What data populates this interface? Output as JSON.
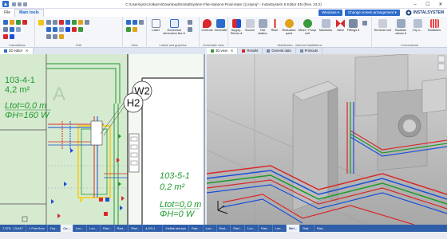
{
  "window": {
    "title": "C:\\Users\\pszczolkarm\\Downloads\\InstalSystem-Flat-stations-Final-state (1).isproj* - InstalSystem 5 Editor EN (Rev. 23.2)",
    "minimize": "–",
    "maximize": "☐",
    "close": "✕"
  },
  "tabs": {
    "file": "File",
    "main_tools": "Main tools"
  },
  "ribbon_right": {
    "windows": "Windows ▾",
    "arrangement": "Change screen arrangement ▾",
    "brand": "INSTALSYSTEM"
  },
  "groups": {
    "calculations": "Calculations",
    "edit": "Edit",
    "view": "View",
    "labels": "Labels and graphics",
    "schematic": "Schematic view",
    "distribution": "Distribution - internal installations",
    "conventional": "Conventional"
  },
  "buttons": {
    "label": "Label",
    "horizontal_dim": "Horizontal dimension line ▾",
    "controls": "Controls",
    "generate": "Generate",
    "supply_return": "Supply-Return ▾",
    "source": "Source",
    "flat_station": "Flat station",
    "riser": "Riser",
    "reduction_point": "Reduction point",
    "mixer_pump": "Mixer / Pump unit",
    "manifolds": "Manifolds",
    "valve": "Valve",
    "fittings": "Fittings ▾",
    "terminal_unit": "Terminal unit",
    "radiator_valves": "Radiator valves ▾",
    "dry_sections": "Dry s...",
    "radiators": "Radiators"
  },
  "doc_tabs": {
    "editor_2d": "2D editor",
    "view_3d": "3D view",
    "results": "Results",
    "general_data": "General data",
    "printouts": "Printouts"
  },
  "drawing": {
    "room_left_number": "103-4-1",
    "room_left_area": "4,2 m²",
    "room_left_length": "Ltot=0,0 m",
    "room_left_power": "ΦH=160 W",
    "room_a_letter": "A",
    "room_mid_number": "103-5-1",
    "room_mid_area": "0,2 m²",
    "room_mid_length": "Ltot=0,0 m",
    "room_mid_power": "ΦH=0 W",
    "bubble_w2": "W2",
    "bubble_h2": "H2"
  },
  "status": {
    "coords": "7,375; -13,647",
    "tabs_left": [
      "1 First floor",
      "Dry...",
      "Co...",
      "Loo...",
      "Loo...",
      "Rad...",
      "Rad...",
      "Rad...",
      "4,2/0,1"
    ],
    "tabs_right": [
      "Visible storeys",
      "Rad...",
      "Loo...",
      "Rad...",
      "Rad...",
      "Loo...",
      "Rad...",
      "Loo...",
      "Wel...",
      "Rad...",
      "Rad..."
    ]
  },
  "colors": {
    "accent": "#2d6ccb",
    "status_bar": "#2f5ea8",
    "room_fill": "#d6ead0",
    "pipe_red": "#d8282b",
    "pipe_blue": "#1a4fd8",
    "pipe_green": "#1f9a2c"
  }
}
